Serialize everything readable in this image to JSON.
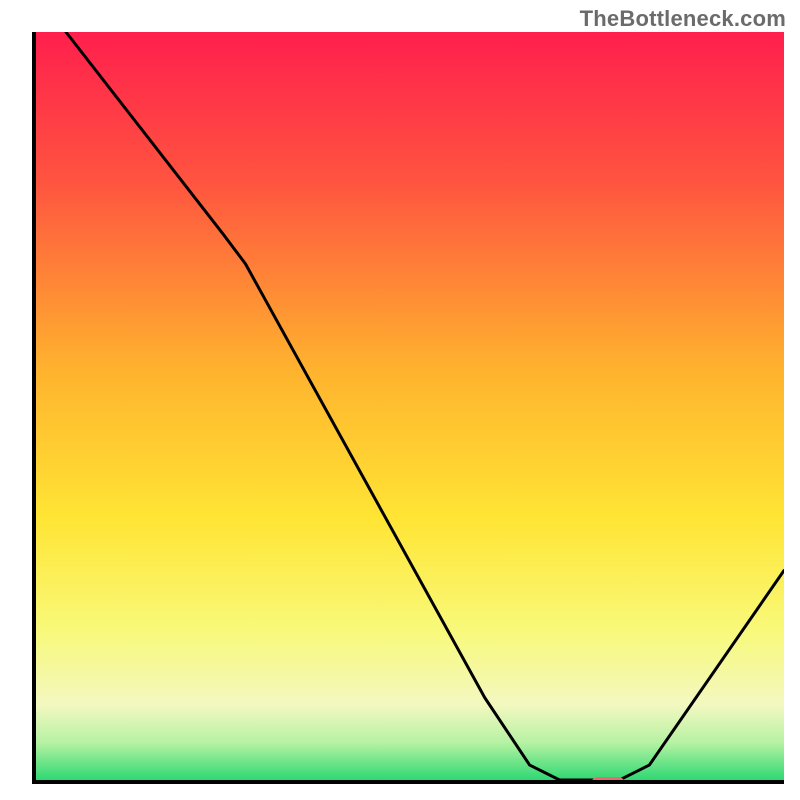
{
  "watermark": "TheBottleneck.com",
  "chart_data": {
    "type": "line",
    "title": "",
    "xlabel": "",
    "ylabel": "",
    "xlim": [
      0,
      100
    ],
    "ylim": [
      0,
      100
    ],
    "grid": false,
    "legend": false,
    "gradient_stops": [
      {
        "offset": 0,
        "color": "#ff1f4d"
      },
      {
        "offset": 20,
        "color": "#ff5440"
      },
      {
        "offset": 45,
        "color": "#ffb22e"
      },
      {
        "offset": 65,
        "color": "#ffe534"
      },
      {
        "offset": 80,
        "color": "#f8f97a"
      },
      {
        "offset": 90,
        "color": "#f3f8c0"
      },
      {
        "offset": 95,
        "color": "#b6f2a3"
      },
      {
        "offset": 100,
        "color": "#2fd873"
      }
    ],
    "curve": [
      {
        "x": 4,
        "y": 100
      },
      {
        "x": 25,
        "y": 73
      },
      {
        "x": 28,
        "y": 69
      },
      {
        "x": 60,
        "y": 11
      },
      {
        "x": 66,
        "y": 2
      },
      {
        "x": 70,
        "y": 0
      },
      {
        "x": 78,
        "y": 0
      },
      {
        "x": 82,
        "y": 2
      },
      {
        "x": 100,
        "y": 28
      }
    ],
    "marker": {
      "x": 76,
      "y": 0
    }
  }
}
